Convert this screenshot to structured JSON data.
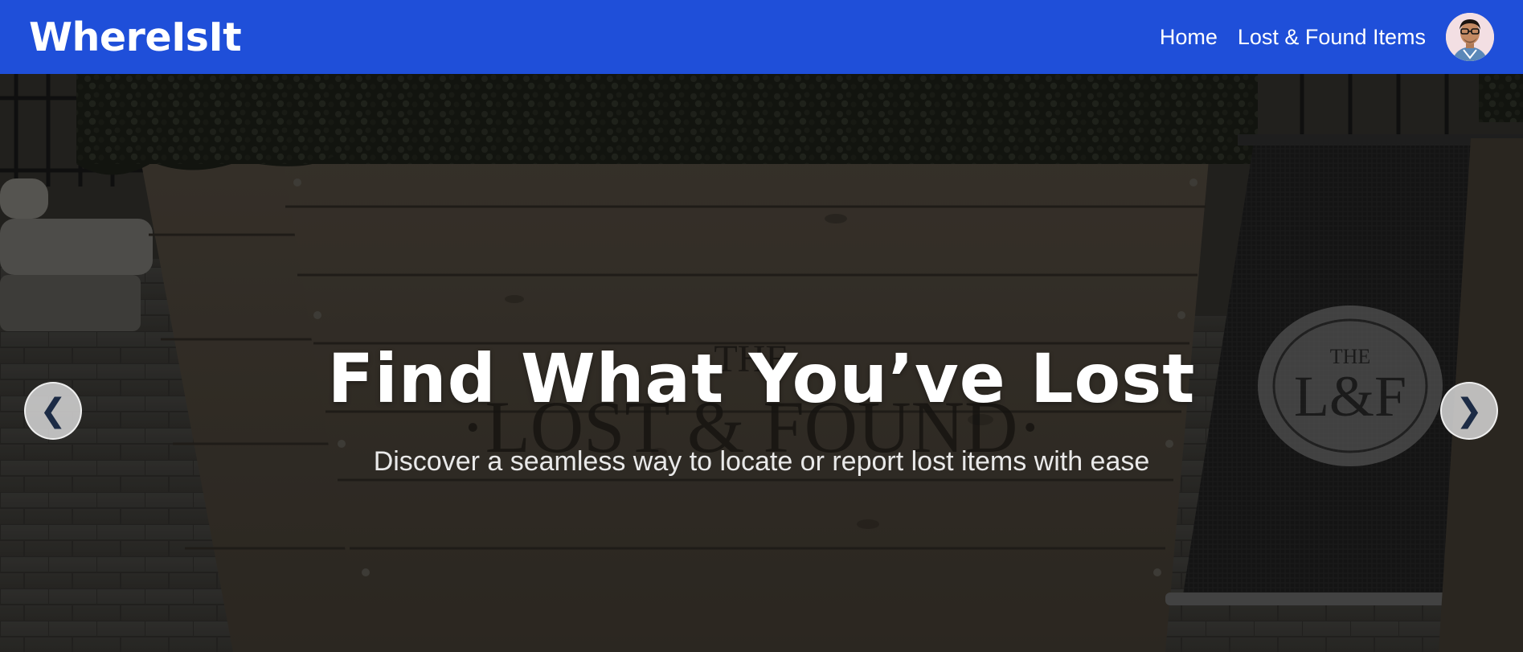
{
  "navbar": {
    "brand": "WhereIsIt",
    "links": [
      "Home",
      "Lost & Found Items"
    ],
    "avatar_icon": "user-avatar",
    "color": "#1f4fd9"
  },
  "hero": {
    "title": "Find What You’ve Lost",
    "subtitle": "Discover a seamless way to locate or report lost items with ease",
    "prev_symbol": "❮",
    "next_symbol": "❯",
    "sign_text_top": "THE",
    "sign_text_main": "·LOST & FOUND·",
    "emblem_top": "THE",
    "emblem_main": "L&F"
  }
}
